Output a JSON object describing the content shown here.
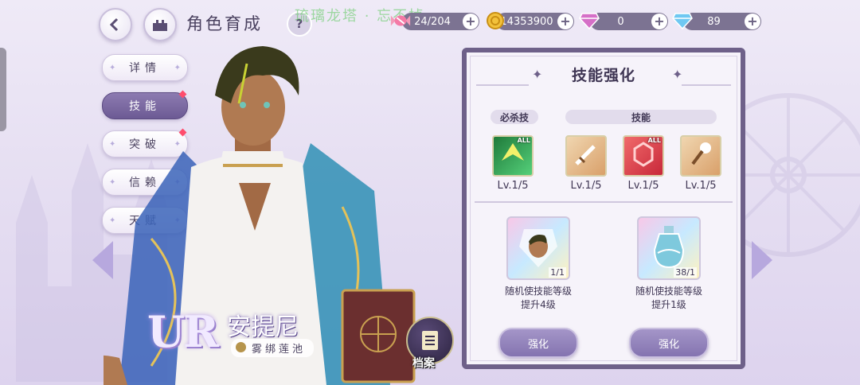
{
  "header": {
    "title": "角色育成",
    "watermark": "琉璃龙塔 · 忘不掉",
    "help": "?"
  },
  "resources": [
    {
      "icon": "candy-icon",
      "value": "24/204"
    },
    {
      "icon": "gold-coin-icon",
      "value": "14353900"
    },
    {
      "icon": "pink-diamond-icon",
      "value": "0"
    },
    {
      "icon": "blue-diamond-icon",
      "value": "89"
    }
  ],
  "menu": [
    {
      "label": "详情",
      "active": false,
      "dot": false
    },
    {
      "label": "技能",
      "active": true,
      "dot": true
    },
    {
      "label": "突破",
      "active": false,
      "dot": true
    },
    {
      "label": "信赖",
      "active": false,
      "dot": false
    },
    {
      "label": "天赋",
      "active": false,
      "dot": false
    }
  ],
  "character": {
    "rarity": "UR",
    "name": "安提尼",
    "subtitle": "雾绑莲池",
    "archive_label": "档案"
  },
  "panel": {
    "title": "技能强化",
    "tag_ultimate": "必杀技",
    "tag_skills": "技能",
    "skills": [
      {
        "icon": "ultimate-skill-icon",
        "badge": "ALL",
        "level": "Lv.1/5",
        "color": "#2faa5a"
      },
      {
        "icon": "sword-skill-icon",
        "badge": "",
        "level": "Lv.1/5",
        "color": "#e9b98a"
      },
      {
        "icon": "hexagon-shield-skill-icon",
        "badge": "ALL",
        "level": "Lv.1/5",
        "color": "#e0484f"
      },
      {
        "icon": "key-skill-icon",
        "badge": "",
        "level": "Lv.1/5",
        "color": "#e9b98a"
      }
    ],
    "items": [
      {
        "icon": "portrait-card-icon",
        "qty": "1/1",
        "desc_line1": "随机使技能等级",
        "desc_line2": "提升4级",
        "button": "强化"
      },
      {
        "icon": "potion-bottle-icon",
        "qty": "38/1",
        "desc_line1": "随机使技能等级",
        "desc_line2": "提升1级",
        "button": "强化"
      }
    ]
  }
}
